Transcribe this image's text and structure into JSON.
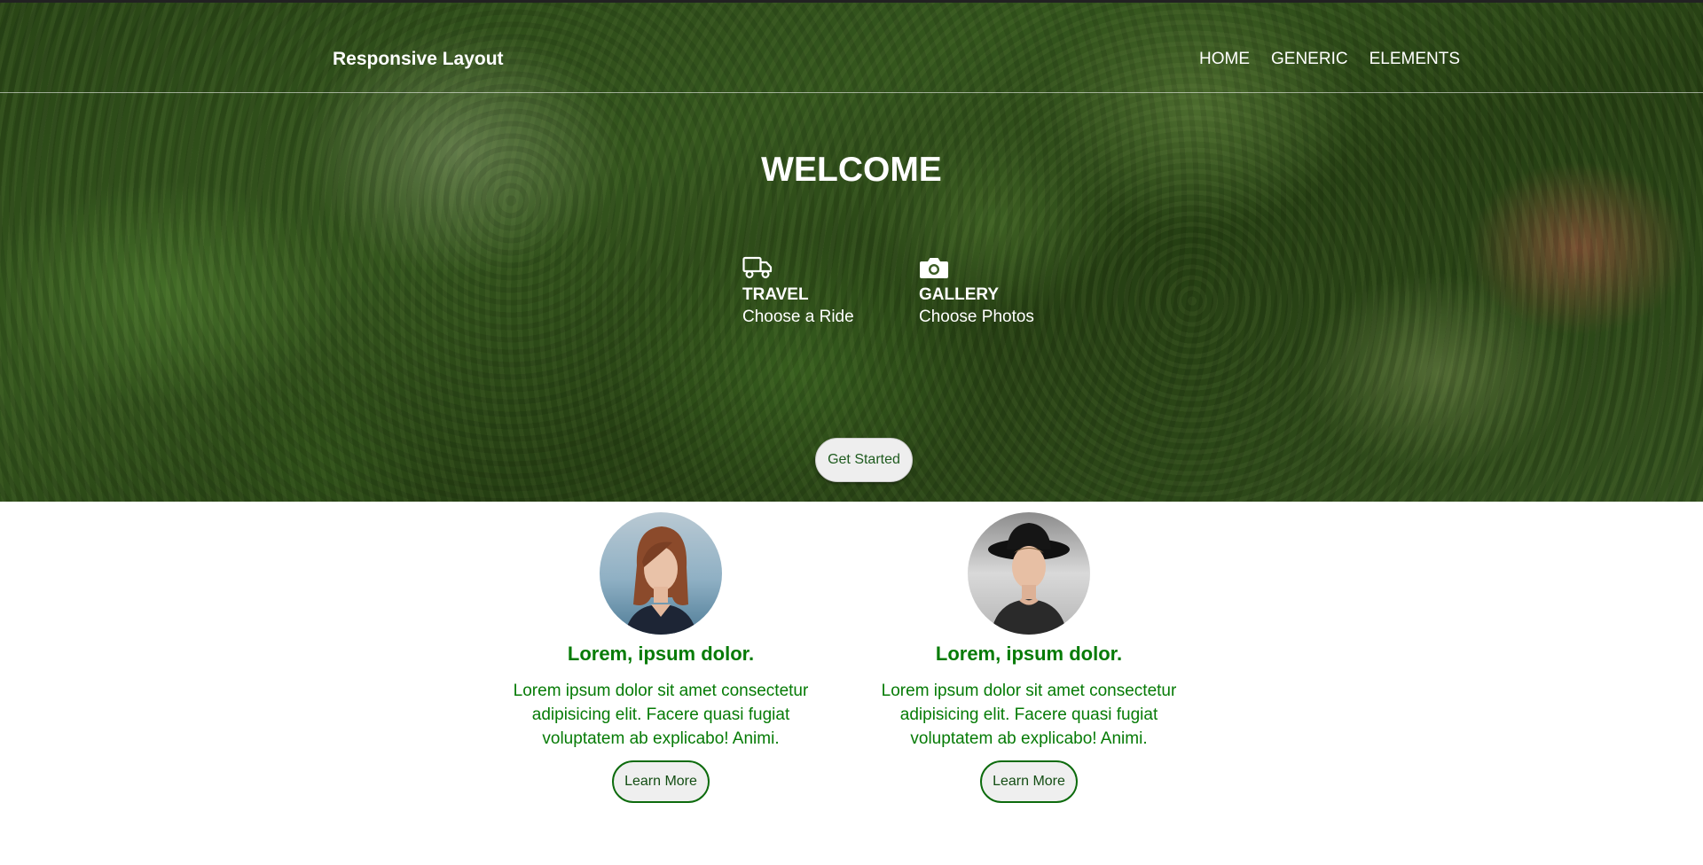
{
  "nav": {
    "brand": "Responsive Layout",
    "links": [
      "HOME",
      "GENERIC",
      "ELEMENTS"
    ]
  },
  "hero": {
    "title": "WELCOME",
    "features": [
      {
        "icon": "truck-icon",
        "title": "TRAVEL",
        "subtitle": "Choose a Ride"
      },
      {
        "icon": "camera-icon",
        "title": "GALLERY",
        "subtitle": "Choose Photos"
      }
    ],
    "cta_label": "Get Started"
  },
  "cards": [
    {
      "title": "Lorem, ipsum dolor.",
      "text": "Lorem ipsum dolor sit amet consectetur adipisicing elit. Facere quasi fugiat voluptatem ab explicabo! Animi.",
      "button": "Learn More"
    },
    {
      "title": "Lorem, ipsum dolor.",
      "text": "Lorem ipsum dolor sit amet consectetur adipisicing elit. Facere quasi fugiat voluptatem ab explicabo! Animi.",
      "button": "Learn More"
    }
  ],
  "colors": {
    "accent_green": "#067b06",
    "button_bg": "#efefef",
    "hero_overlay": "#2f4f1a"
  }
}
